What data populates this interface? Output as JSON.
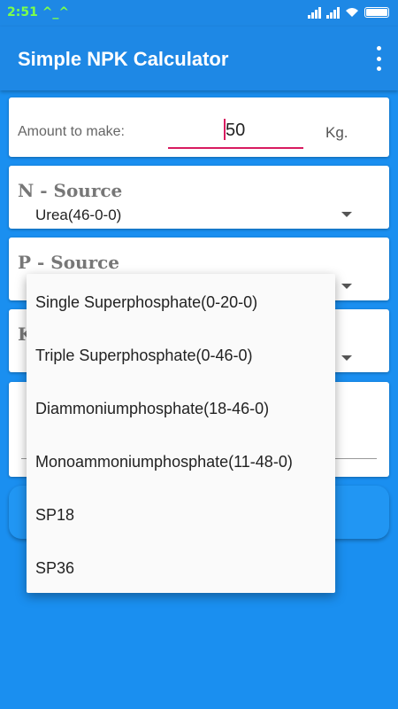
{
  "status": {
    "time": "2:51 ^_^"
  },
  "app": {
    "title": "Simple NPK Calculator"
  },
  "amount": {
    "label": "Amount to make:",
    "value": "50",
    "unit": "Kg."
  },
  "n_source": {
    "title": "N - Source",
    "value": "Urea(46-0-0)"
  },
  "p_source": {
    "title": "P - Source"
  },
  "k_source": {
    "title_partial": "K"
  },
  "dropdown": {
    "items": [
      "Single Superphosphate(0-20-0)",
      "Triple Superphosphate(0-46-0)",
      "Diammoniumphosphate(18-46-0)",
      "Monoammoniumphosphate(11-48-0)",
      "SP18",
      "SP36"
    ]
  },
  "colors": {
    "primary": "#1e88e5",
    "background": "#1a8ff0",
    "accent": "#d81b60"
  }
}
